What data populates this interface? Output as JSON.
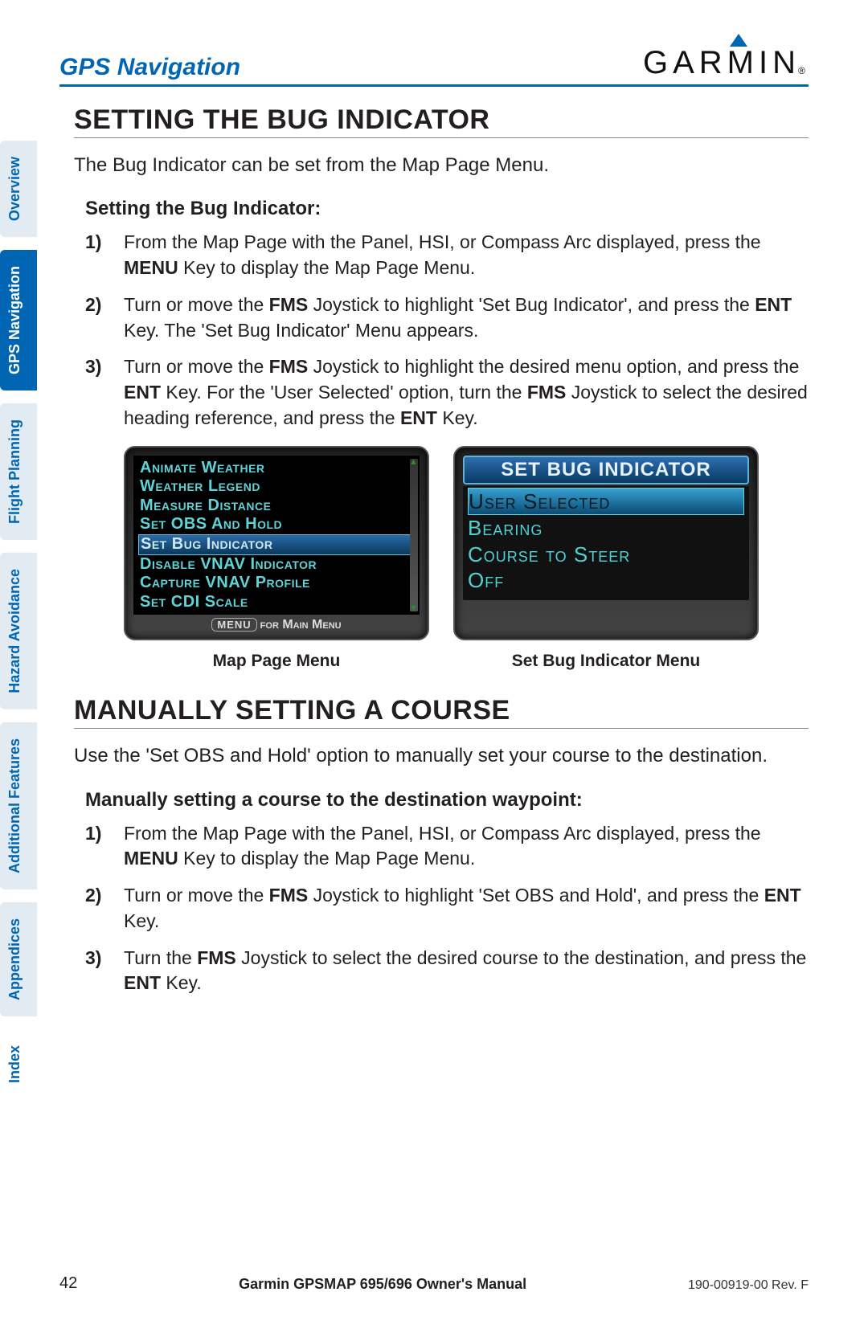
{
  "header": {
    "section": "GPS Navigation",
    "brand": "GARMIN"
  },
  "tabs": [
    {
      "label": "Overview",
      "state": "normal"
    },
    {
      "label": "GPS Navigation",
      "state": "active"
    },
    {
      "label": "Flight Planning",
      "state": "normal"
    },
    {
      "label": "Hazard Avoidance",
      "state": "normal"
    },
    {
      "label": "Additional Features",
      "state": "normal"
    },
    {
      "label": "Appendices",
      "state": "normal"
    },
    {
      "label": "Index",
      "state": "plain"
    }
  ],
  "section1": {
    "heading": "SETTING THE BUG INDICATOR",
    "intro": "The Bug Indicator can be set from the Map Page Menu.",
    "subheading": "Setting the Bug Indicator:",
    "steps": [
      {
        "num": "1)",
        "pre": "From the Map Page with the Panel, HSI, or Compass Arc displayed, press the ",
        "b1": "MENU",
        "post1": " Key to display the Map Page Menu."
      },
      {
        "num": "2)",
        "pre": "Turn or move the ",
        "b1": "FMS",
        "mid1": " Joystick to highlight 'Set Bug Indicator', and press the ",
        "b2": "ENT",
        "post1": " Key.  The 'Set Bug Indicator' Menu appears."
      },
      {
        "num": "3)",
        "pre": "Turn or move the ",
        "b1": "FMS",
        "mid1": " Joystick to highlight the desired menu option, and press the ",
        "b2": "ENT",
        "mid2": " Key.  For the 'User Selected' option, turn the ",
        "b3": "FMS",
        "mid3": " Joystick to select the desired heading reference, and press the ",
        "b4": "ENT",
        "post1": " Key."
      }
    ]
  },
  "screens": {
    "mapMenu": {
      "items": [
        "Animate Weather",
        "Weather Legend",
        "Measure Distance",
        "Set OBS and Hold",
        "Set Bug Indicator",
        "Disable VNAV Indicator",
        "Capture VNAV Profile",
        "Set CDI Scale"
      ],
      "highlightIndex": 4,
      "footerKey": "MENU",
      "footerText": "for Main Menu",
      "caption": "Map Page Menu"
    },
    "sbiMenu": {
      "title": "SET BUG INDICATOR",
      "options": [
        "User Selected",
        "Bearing",
        "Course to Steer",
        "Off"
      ],
      "highlightIndex": 0,
      "caption": "Set Bug Indicator Menu"
    }
  },
  "section2": {
    "heading": "MANUALLY SETTING A COURSE",
    "intro": "Use the 'Set OBS and Hold' option to manually set your course to the destination.",
    "subheading": "Manually setting a course to the destination waypoint:",
    "steps": [
      {
        "num": "1)",
        "pre": "From the Map Page with the Panel, HSI, or Compass Arc displayed, press the ",
        "b1": "MENU",
        "post1": " Key to display the Map Page Menu."
      },
      {
        "num": "2)",
        "pre": "Turn or move the ",
        "b1": "FMS",
        "mid1": " Joystick to highlight 'Set OBS and Hold', and press the ",
        "b2": "ENT",
        "post1": " Key."
      },
      {
        "num": "3)",
        "pre": "Turn the ",
        "b1": "FMS",
        "mid1": " Joystick to select the desired course to the destination, and press the ",
        "b2": "ENT",
        "post1": " Key."
      }
    ]
  },
  "footer": {
    "page": "42",
    "title": "Garmin GPSMAP 695/696 Owner's Manual",
    "rev": "190-00919-00  Rev. F"
  }
}
